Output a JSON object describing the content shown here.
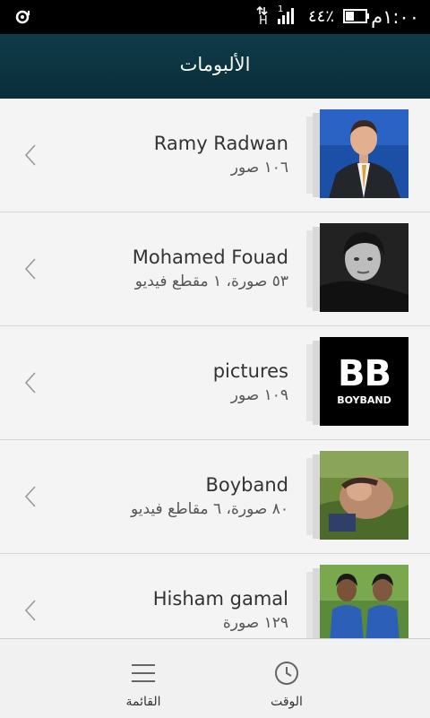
{
  "status_bar": {
    "time": "١:٠٠م",
    "battery_percent": "٤٤٪",
    "network_type": "H",
    "sim_label": "1",
    "battery_level": 0.44
  },
  "header": {
    "title": "الألبومات"
  },
  "albums": [
    {
      "name": "Ramy Radwan",
      "count": "١٠٦ صور",
      "thumbnail": "man-in-suit-photo"
    },
    {
      "name": "Mohamed Fouad",
      "count": "٥٣ صورة، ١ مقطع فيديو",
      "thumbnail": "black-and-white-portrait-photo"
    },
    {
      "name": "pictures",
      "count": "١٠٩ صور",
      "thumbnail": "bb-boyband-logo",
      "thumb_text_big": "BB",
      "thumb_text_small": "BOYBAND"
    },
    {
      "name": "Boyband",
      "count": "٨٠ صورة، ٦ مقاطع فيديو",
      "thumbnail": "outdoor-photo"
    },
    {
      "name": "Hisham gamal",
      "count": "١٢٩ صورة",
      "thumbnail": "group-photo-blue-shirts"
    }
  ],
  "bottom_nav": {
    "list_label": "القائمة",
    "time_label": "الوقت",
    "list_icon": "menu-icon",
    "time_icon": "clock-icon"
  }
}
